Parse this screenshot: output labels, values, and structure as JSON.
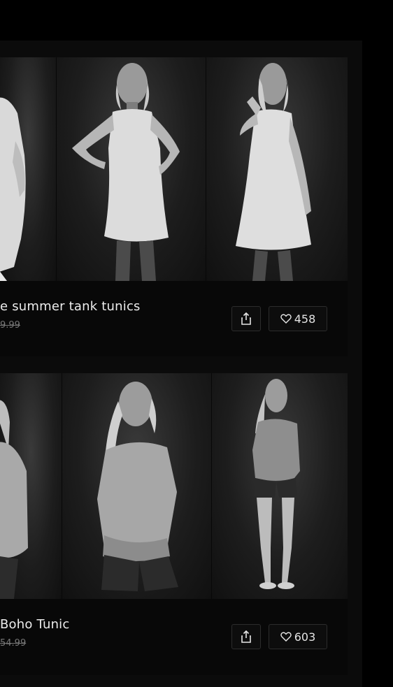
{
  "feed": {
    "pins": [
      {
        "title": "e summer tank tunics",
        "price": "9.99",
        "likes": "458",
        "share_icon": "share-icon",
        "like_icon": "heart-icon"
      },
      {
        "title": "Boho Tunic",
        "price": "54.99",
        "likes": "603",
        "share_icon": "share-icon",
        "like_icon": "heart-icon"
      }
    ]
  }
}
